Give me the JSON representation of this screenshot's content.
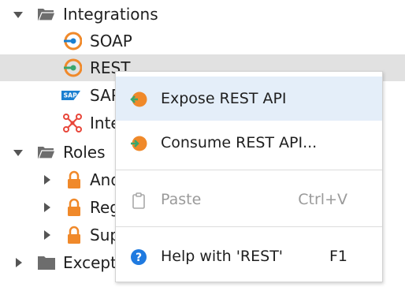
{
  "tree": {
    "items": [
      {
        "label": "Integrations"
      },
      {
        "label": "SOAP"
      },
      {
        "label": "REST"
      },
      {
        "label": "SAP"
      },
      {
        "label": "Inte"
      },
      {
        "label": "Roles"
      },
      {
        "label": "And"
      },
      {
        "label": "Reg"
      },
      {
        "label": "Sup"
      },
      {
        "label": "Except"
      }
    ],
    "sap_badge": "SAP"
  },
  "context_menu": {
    "items": [
      {
        "label": "Expose REST API",
        "shortcut": ""
      },
      {
        "label": "Consume REST API...",
        "shortcut": ""
      },
      {
        "label": "Paste",
        "shortcut": "Ctrl+V"
      },
      {
        "label": "Help with 'REST'",
        "shortcut": "F1"
      }
    ],
    "help_glyph": "?"
  },
  "colors": {
    "selected_row": "#e1e1e1",
    "menu_hover": "#e4eef9",
    "orange": "#f0892a",
    "green": "#3aa76d",
    "blue_sap": "#1a7fd0",
    "blue_help": "#1f7ae0",
    "red_connector": "#e8463a",
    "folder": "#6d6d6d"
  }
}
